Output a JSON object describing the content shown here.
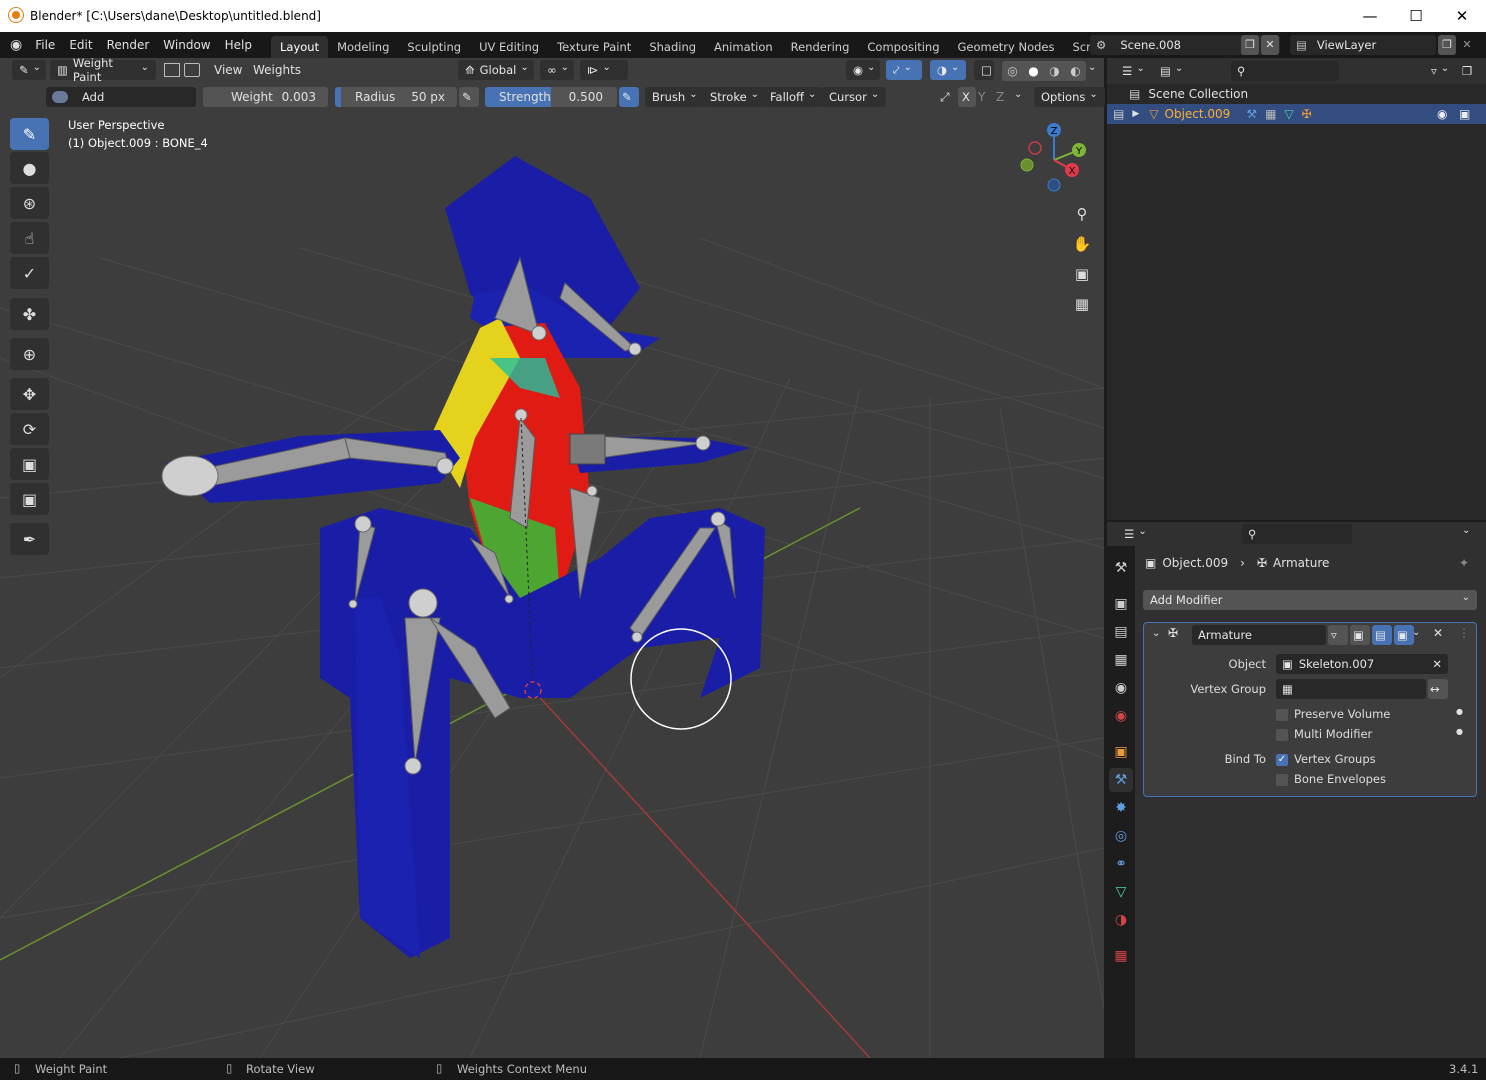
{
  "window": {
    "title": "Blender* [C:\\Users\\dane\\Desktop\\untitled.blend]",
    "minimize_icon": "minimize-icon",
    "maximize_icon": "maximize-icon",
    "close_icon": "close-icon"
  },
  "menu": {
    "items": [
      "File",
      "Edit",
      "Render",
      "Window",
      "Help"
    ]
  },
  "workspaces": [
    "Layout",
    "Modeling",
    "Sculpting",
    "UV Editing",
    "Texture Paint",
    "Shading",
    "Animation",
    "Rendering",
    "Compositing",
    "Geometry Nodes",
    "Scripting"
  ],
  "active_workspace": "Layout",
  "scene": {
    "name": "Scene.008",
    "view_layer": "ViewLayer"
  },
  "viewport_header": {
    "mode": "Weight Paint",
    "view_menu": "View",
    "weights_menu": "Weights",
    "orientation": "Global"
  },
  "tool_settings": {
    "blend": "Add",
    "weight_label": "Weight",
    "weight_value": "0.003",
    "radius_label": "Radius",
    "radius_value": "50 px",
    "strength_label": "Strength",
    "strength_value": "0.500",
    "strength_fraction": 0.5,
    "brush": "Brush",
    "stroke": "Stroke",
    "falloff": "Falloff",
    "cursor": "Cursor",
    "axis_x": "X",
    "axis_y": "Y",
    "axis_z": "Z",
    "options": "Options"
  },
  "viewport": {
    "perspective_label": "User Perspective",
    "object_label": "(1) Object.009 : BONE_4",
    "gizmo": {
      "x": "X",
      "y": "Y",
      "z": "Z"
    }
  },
  "outliner": {
    "collection": "Scene Collection",
    "object": "Object.009"
  },
  "properties": {
    "breadcrumb_object": "Object.009",
    "breadcrumb_modifier": "Armature",
    "add_modifier": "Add Modifier",
    "modifier_name": "Armature",
    "object_label": "Object",
    "object_value": "Skeleton.007",
    "vertex_group_label": "Vertex Group",
    "preserve_volume": "Preserve Volume",
    "multi_modifier": "Multi Modifier",
    "bind_to_label": "Bind To",
    "vertex_groups": "Vertex Groups",
    "bone_envelopes": "Bone Envelopes"
  },
  "status_bar": {
    "left": "Weight Paint",
    "middle": "Rotate View",
    "right": "Weights Context Menu",
    "version": "3.4.1"
  }
}
